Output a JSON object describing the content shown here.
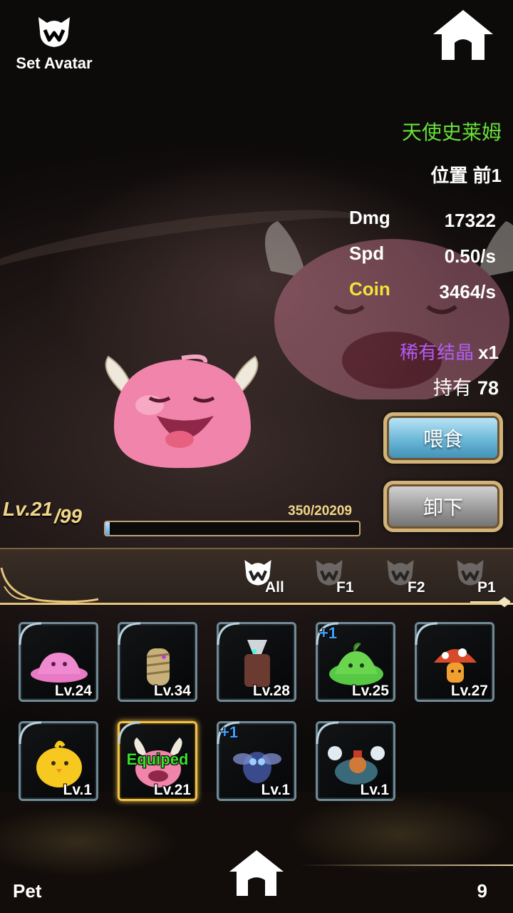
{
  "header": {
    "avatar_label": "Set Avatar",
    "avatar_icon": "wolf-logo-icon",
    "home_icon": "home-icon"
  },
  "pet": {
    "name": "天使史莱姆",
    "position": "位置 前1",
    "stats": [
      {
        "label": "Dmg",
        "value": "17322",
        "color": "#ffffff"
      },
      {
        "label": "Spd",
        "value": "0.50/s",
        "color": "#ffffff"
      },
      {
        "label": "Coin",
        "value": "3464/s",
        "color": "#f5e23a"
      }
    ],
    "rare_crystal_label": "稀有结晶",
    "rare_crystal_qty": "x1",
    "held_label": "持有",
    "held_value": "78",
    "level_current": "Lv.21",
    "level_max": "/99",
    "exp_text": "350/20209",
    "exp_fraction": 0.0173
  },
  "actions": {
    "feed_label": "喂食",
    "unequip_label": "卸下"
  },
  "filters": [
    {
      "label": "All",
      "active": true
    },
    {
      "label": "F1",
      "active": false
    },
    {
      "label": "F2",
      "active": false
    },
    {
      "label": "P1",
      "active": false
    }
  ],
  "inventory": [
    {
      "creature": "pink-blob",
      "level": "Lv.24",
      "plus": "",
      "equipped": ""
    },
    {
      "creature": "mummy",
      "level": "Lv.34",
      "plus": "",
      "equipped": ""
    },
    {
      "creature": "tree-spirit",
      "level": "Lv.28",
      "plus": "",
      "equipped": ""
    },
    {
      "creature": "green-slime",
      "level": "Lv.25",
      "plus": "+1",
      "equipped": ""
    },
    {
      "creature": "mushroom",
      "level": "Lv.27",
      "plus": "",
      "equipped": ""
    },
    {
      "creature": "yellow-chick",
      "level": "Lv.1",
      "plus": "",
      "equipped": ""
    },
    {
      "creature": "angel-slime",
      "level": "Lv.21",
      "plus": "",
      "equipped": "Equiped"
    },
    {
      "creature": "blue-fly",
      "level": "Lv.1",
      "plus": "+1",
      "equipped": ""
    },
    {
      "creature": "crab",
      "level": "Lv.1",
      "plus": "",
      "equipped": ""
    }
  ],
  "footer": {
    "section_label": "Pet",
    "count": "9"
  },
  "colors": {
    "name_green": "#66e13a",
    "coin_yellow": "#f5e23a",
    "rare_purple": "#b25cf2",
    "level_gold": "#f0d68a",
    "selected_border": "#f0c24a",
    "plus_blue": "#3fa0ff",
    "equipped_green": "#39e02c"
  }
}
